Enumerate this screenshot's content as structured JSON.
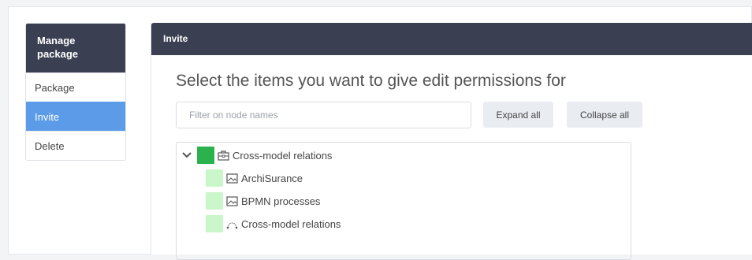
{
  "sidebar": {
    "title": "Manage package",
    "items": [
      {
        "label": "Package",
        "active": false
      },
      {
        "label": "Invite",
        "active": true
      },
      {
        "label": "Delete",
        "active": false
      }
    ]
  },
  "panel": {
    "title": "Invite",
    "heading": "Select the items you want to give edit permissions for",
    "filter_placeholder": "Filter on node names",
    "expand_label": "Expand all",
    "collapse_label": "Collapse all"
  },
  "tree": {
    "root": {
      "label": "Cross-model relations",
      "icon": "package-icon"
    },
    "children": [
      {
        "label": "ArchiSurance",
        "icon": "view-icon"
      },
      {
        "label": "BPMN processes",
        "icon": "view-icon"
      },
      {
        "label": "Cross-model relations",
        "icon": "relations-icon"
      }
    ]
  },
  "colors": {
    "header_bg": "#3b3f52",
    "active_item": "#5b9be8",
    "selected_green": "#2bb24c",
    "light_green": "#c9f7c9"
  }
}
